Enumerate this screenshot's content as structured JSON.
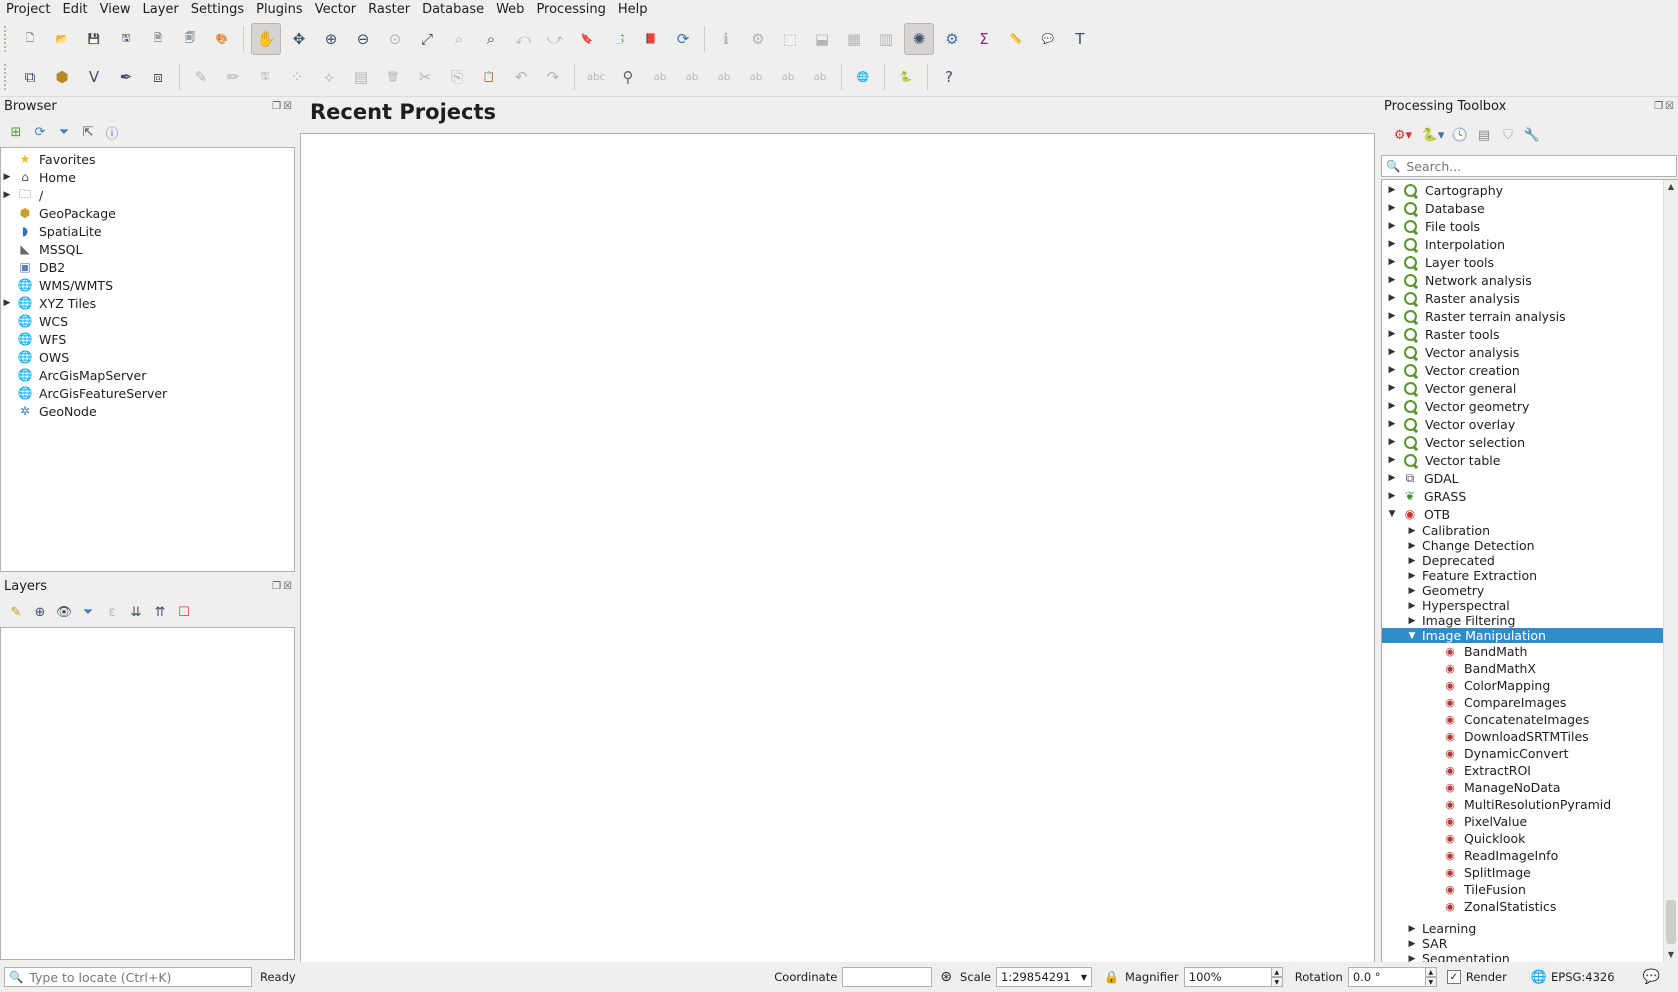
{
  "menu": [
    "Project",
    "Edit",
    "View",
    "Layer",
    "Settings",
    "Plugins",
    "Vector",
    "Raster",
    "Database",
    "Web",
    "Processing",
    "Help"
  ],
  "toolbar1_icons": [
    "new-project-icon",
    "open-project-icon",
    "save-project-icon",
    "save-as-icon",
    "new-layout-icon",
    "layout-manager-icon",
    "style-manager-icon",
    "|",
    "pan-icon",
    "pan-to-selection-icon",
    "zoom-in-icon",
    "zoom-out-icon",
    "zoom-native-icon",
    "zoom-full-icon",
    "zoom-to-selection-icon",
    "zoom-to-layer-icon",
    "zoom-last-icon",
    "zoom-next-icon",
    "new-bookmark-icon",
    "show-bookmarks-icon",
    "show-spatial-bookmarks-icon",
    "refresh-icon",
    "|",
    "identify-icon",
    "action-icon",
    "select-features-icon",
    "deselect-icon",
    "open-attribute-table-icon",
    "field-calculator-icon",
    "statistics-icon",
    "processing-toolbox-icon",
    "sum-icon",
    "measure-icon",
    "map-tips-icon",
    "text-annotation-icon"
  ],
  "toolbar2_icons": [
    "data-source-manager-icon",
    "new-geopackage-icon",
    "add-vector-icon",
    "digitize-icon",
    "new-virtual-layer-icon",
    "|",
    "edit-pencil-icon",
    "toggle-editing-icon",
    "save-edits-icon",
    "add-feature-icon",
    "vertex-tool-icon",
    "modify-attributes-icon",
    "delete-selected-icon",
    "cut-features-icon",
    "copy-features-icon",
    "paste-features-icon",
    "undo-icon",
    "redo-icon",
    "|",
    "label-icon",
    "pin-label-icon",
    "layer-labeling-icon",
    "show-hide-labels-icon",
    "move-label-icon",
    "rotate-label-icon",
    "change-label-icon",
    "label-toolbar-icon",
    "|",
    "georeferencer-icon",
    "|",
    "python-icon",
    "|",
    "help-icon"
  ],
  "browser": {
    "title": "Browser",
    "items": [
      {
        "label": "Favorites",
        "icon": "star-icon",
        "expandable": false
      },
      {
        "label": "Home",
        "icon": "home-folder-icon",
        "expandable": true
      },
      {
        "label": "/",
        "icon": "folder-icon",
        "expandable": true
      },
      {
        "label": "GeoPackage",
        "icon": "geopackage-icon",
        "expandable": false
      },
      {
        "label": "SpatiaLite",
        "icon": "spatialite-icon",
        "expandable": false
      },
      {
        "label": "MSSQL",
        "icon": "mssql-icon",
        "expandable": false
      },
      {
        "label": "DB2",
        "icon": "db2-icon",
        "expandable": false
      },
      {
        "label": "WMS/WMTS",
        "icon": "globe-icon",
        "expandable": false
      },
      {
        "label": "XYZ Tiles",
        "icon": "globe-icon",
        "expandable": true
      },
      {
        "label": "WCS",
        "icon": "globe-icon",
        "expandable": false
      },
      {
        "label": "WFS",
        "icon": "globe-icon",
        "expandable": false
      },
      {
        "label": "OWS",
        "icon": "globe-icon",
        "expandable": false
      },
      {
        "label": "ArcGisMapServer",
        "icon": "globe-icon",
        "expandable": false
      },
      {
        "label": "ArcGisFeatureServer",
        "icon": "globe-icon",
        "expandable": false
      },
      {
        "label": "GeoNode",
        "icon": "geonode-icon",
        "expandable": false
      }
    ]
  },
  "layers": {
    "title": "Layers"
  },
  "center": {
    "title": "Recent Projects"
  },
  "toolbox": {
    "title": "Processing Toolbox",
    "search_placeholder": "Search...",
    "groups": [
      "Cartography",
      "Database",
      "File tools",
      "Interpolation",
      "Layer tools",
      "Network analysis",
      "Raster analysis",
      "Raster terrain analysis",
      "Raster tools",
      "Vector analysis",
      "Vector creation",
      "Vector general",
      "Vector geometry",
      "Vector overlay",
      "Vector selection",
      "Vector table"
    ],
    "providers": [
      "GDAL",
      "GRASS",
      "OTB"
    ],
    "otb_groups_before": [
      "Calibration",
      "Change Detection",
      "Deprecated",
      "Feature Extraction",
      "Geometry",
      "Hyperspectral",
      "Image Filtering"
    ],
    "selected_group": "Image Manipulation",
    "algorithms": [
      "BandMath",
      "BandMathX",
      "ColorMapping",
      "CompareImages",
      "ConcatenateImages",
      "DownloadSRTMTiles",
      "DynamicConvert",
      "ExtractROI",
      "ManageNoData",
      "MultiResolutionPyramid",
      "PixelValue",
      "Quicklook",
      "ReadImageInfo",
      "SplitImage",
      "TileFusion",
      "ZonalStatistics"
    ],
    "otb_groups_after": [
      "Learning",
      "SAR",
      "Segmentation"
    ]
  },
  "status": {
    "locate_placeholder": "Type to locate (Ctrl+K)",
    "ready": "Ready",
    "coordinate_label": "Coordinate",
    "coordinate_value": "",
    "scale_label": "Scale",
    "scale_value": "1:29854291",
    "magnifier_label": "Magnifier",
    "magnifier_value": "100%",
    "rotation_label": "Rotation",
    "rotation_value": "0.0 °",
    "render_label": "Render",
    "render_checked": true,
    "crs": "EPSG:4326"
  }
}
